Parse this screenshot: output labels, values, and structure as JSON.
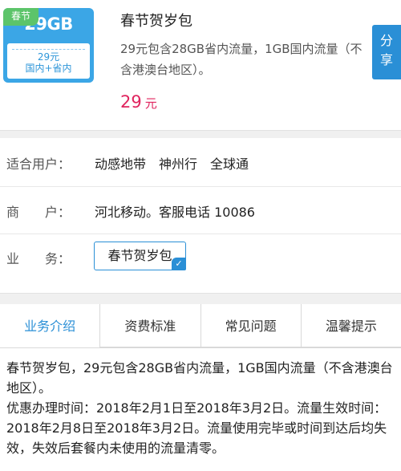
{
  "product": {
    "corner_tag": "春节",
    "card_data": "29GB",
    "card_price": "29元",
    "card_scope": "国内+省内",
    "title": "春节贺岁包",
    "description": "29元包含28GB省内流量，1GB国内流量（不含港澳台地区）。",
    "price_value": "29",
    "price_unit": "元",
    "share_label": "分享"
  },
  "info": {
    "users_label": "适合用户：",
    "users_value": "动感地带　神州行　全球通",
    "merchant_label": "商　　户：",
    "merchant_value": "河北移动。客服电话 10086",
    "business_label": "业　　务：",
    "business_value": "春节贺岁包",
    "check_icon": "✓"
  },
  "tabs": [
    {
      "label": "业务介绍",
      "active": true
    },
    {
      "label": "资费标准",
      "active": false
    },
    {
      "label": "常见问题",
      "active": false
    },
    {
      "label": "温馨提示",
      "active": false
    }
  ],
  "content": {
    "paragraph1": "春节贺岁包，29元包含28GB省内流量，1GB国内流量（不含港澳台地区）。",
    "paragraph2": "优惠办理时间：2018年2月1日至2018年3月2日。流量生效时间：2018年2月8日至2018年3月2日。流量使用完毕或时间到达后均失效，失效后套餐内未使用的流量清零。"
  },
  "colors": {
    "accent": "#2a8fd6",
    "price": "#e0245e",
    "tag_green": "#5cc46a"
  }
}
